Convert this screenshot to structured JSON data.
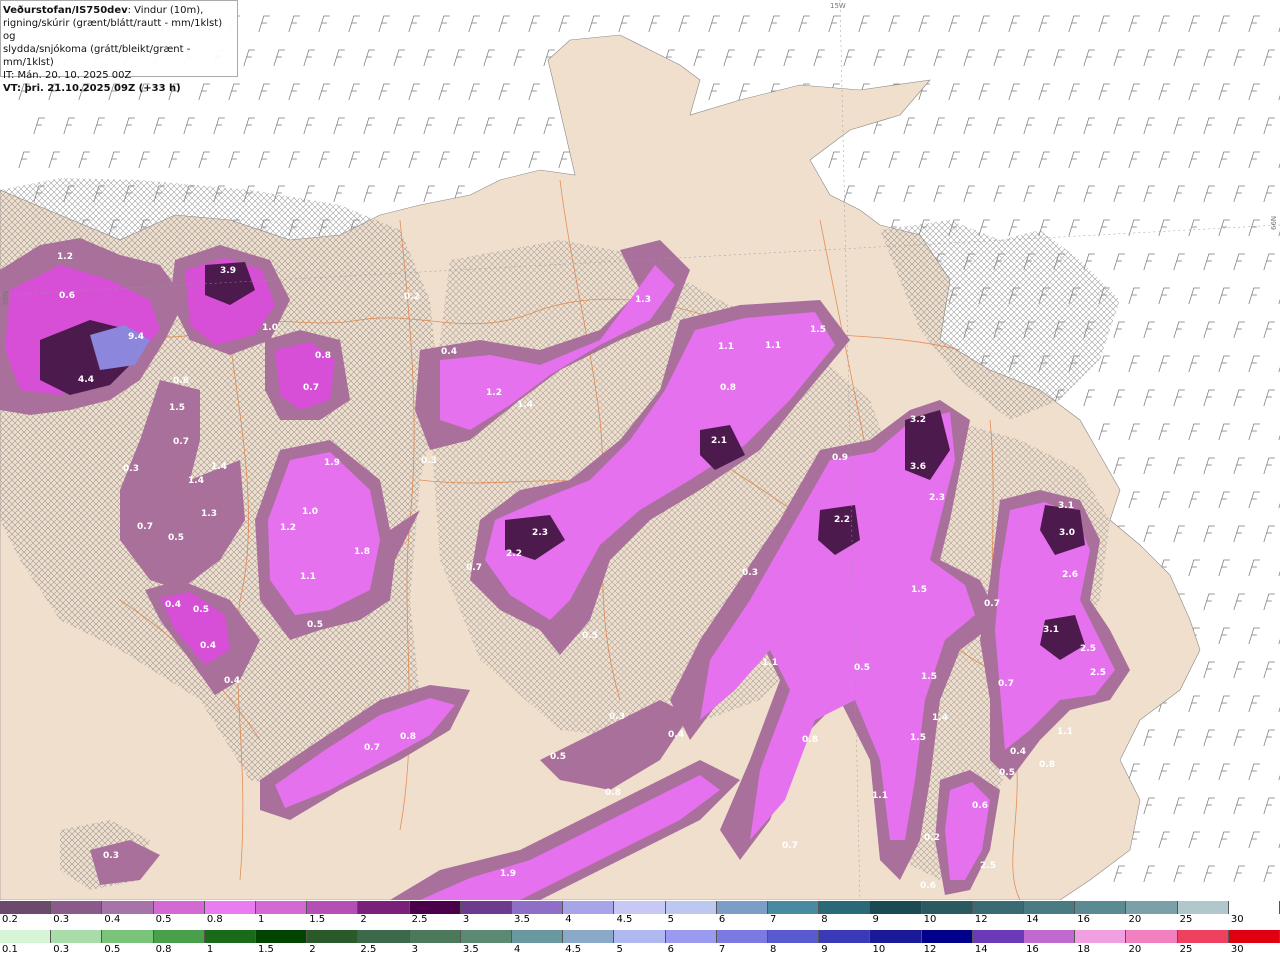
{
  "header": {
    "source": "Veðurstofan/IS750dev",
    "line1_rest": ": Vindur (10m),",
    "line2": "rigning/skúrir (grænt/blátt/rautt - mm/1klst) og",
    "line3": "slydda/snjókoma (grátt/bleikt/grænt - mm/1klst)",
    "init": "IT: Mán. 20. 10. 2025 00Z",
    "valid": "VT: þri. 21.10.2025 09Z (+33 h)"
  },
  "map": {
    "coord_labels": [
      "15W",
      "66N",
      "66N"
    ],
    "colors": {
      "sea": "#ffffff",
      "land": "#f0dfcd",
      "roads": "#e07a3a",
      "precip_light": "#a8709a",
      "precip_mid": "#d74fd7",
      "precip_bright": "#e571ee",
      "precip_dark": "#4d1a4d",
      "precip_peak": "#8c86dc"
    },
    "precip_labels": [
      {
        "v": "1.2"
      },
      {
        "v": "3.9"
      },
      {
        "v": "0.6"
      },
      {
        "v": "9.4"
      },
      {
        "v": "4.4"
      },
      {
        "v": "1.0"
      },
      {
        "v": "0.8"
      },
      {
        "v": "0.7"
      },
      {
        "v": "0.8"
      },
      {
        "v": "1.5"
      },
      {
        "v": "0.7"
      },
      {
        "v": "0.3"
      },
      {
        "v": "1.4"
      },
      {
        "v": "1.4"
      },
      {
        "v": "1.3"
      },
      {
        "v": "0.7"
      },
      {
        "v": "0.5"
      },
      {
        "v": "1.9"
      },
      {
        "v": "1.0"
      },
      {
        "v": "1.2"
      },
      {
        "v": "1.8"
      },
      {
        "v": "1.1"
      },
      {
        "v": "0.4"
      },
      {
        "v": "0.5"
      },
      {
        "v": "0.4"
      },
      {
        "v": "0.4"
      },
      {
        "v": "0.5"
      },
      {
        "v": "0.2"
      },
      {
        "v": "0.4"
      },
      {
        "v": "1.2"
      },
      {
        "v": "1.4"
      },
      {
        "v": "0.3"
      },
      {
        "v": "1.3"
      },
      {
        "v": "1.1"
      },
      {
        "v": "1.1"
      },
      {
        "v": "1.5"
      },
      {
        "v": "0.8"
      },
      {
        "v": "2.1"
      },
      {
        "v": "2.3"
      },
      {
        "v": "2.2"
      },
      {
        "v": "0.7"
      },
      {
        "v": "0.5"
      },
      {
        "v": "0.9"
      },
      {
        "v": "3.2"
      },
      {
        "v": "3.6"
      },
      {
        "v": "2.3"
      },
      {
        "v": "2.2"
      },
      {
        "v": "0.3"
      },
      {
        "v": "1.5"
      },
      {
        "v": "0.7"
      },
      {
        "v": "3.1"
      },
      {
        "v": "3.0"
      },
      {
        "v": "2.6"
      },
      {
        "v": "3.1"
      },
      {
        "v": "2.5"
      },
      {
        "v": "2.5"
      },
      {
        "v": "0.7"
      },
      {
        "v": "1.1"
      },
      {
        "v": "0.5"
      },
      {
        "v": "1.5"
      },
      {
        "v": "1.4"
      },
      {
        "v": "1.5"
      },
      {
        "v": "0.7"
      },
      {
        "v": "0.8"
      },
      {
        "v": "0.5"
      },
      {
        "v": "0.3"
      },
      {
        "v": "0.4"
      },
      {
        "v": "0.8"
      },
      {
        "v": "0.8"
      },
      {
        "v": "1.1"
      },
      {
        "v": "0.4"
      },
      {
        "v": "0.5"
      },
      {
        "v": "0.8"
      },
      {
        "v": "1.1"
      },
      {
        "v": "0.6"
      },
      {
        "v": "0.2"
      },
      {
        "v": "0.7"
      },
      {
        "v": "2.5"
      },
      {
        "v": "0.6"
      },
      {
        "v": "0.3"
      },
      {
        "v": "1.9"
      }
    ]
  },
  "legend_rain_snow": {
    "labels": [
      "0.2",
      "0.3",
      "0.4",
      "0.5",
      "0.8",
      "1",
      "1.5",
      "2",
      "2.5",
      "3",
      "3.5",
      "4",
      "4.5",
      "5",
      "6",
      "7",
      "8",
      "9",
      "10",
      "12",
      "14",
      "16",
      "20",
      "25",
      "30"
    ],
    "colors": [
      "#6b4a6b",
      "#8a5a8a",
      "#a874a8",
      "#d36ad3",
      "#ea7bf0",
      "#d36ad3",
      "#b54fb5",
      "#7a1f7a",
      "#4b004b",
      "#6e3a8e",
      "#8f6ec7",
      "#a8a4e8",
      "#c8c8f5",
      "#bcc8f0",
      "#7a9ec8",
      "#4a8aa0",
      "#2a6a78",
      "#1a4a52",
      "#2a5a60",
      "#3a6a72",
      "#4a7a82",
      "#5a8a92",
      "#7aa0a8",
      "#b0c8cc",
      "#ffffff"
    ]
  },
  "legend_rain": {
    "labels": [
      "0.1",
      "0.3",
      "0.5",
      "0.8",
      "1",
      "1.5",
      "2",
      "2.5",
      "3",
      "3.5",
      "4",
      "4.5",
      "5",
      "6",
      "7",
      "8",
      "9",
      "10",
      "12",
      "14",
      "16",
      "18",
      "20",
      "25",
      "30"
    ],
    "colors": [
      "#d6f5d6",
      "#a8dca8",
      "#7ac47a",
      "#4aa04a",
      "#1a6a1a",
      "#004400",
      "#2a5a2a",
      "#3a6a4a",
      "#4a7a5a",
      "#5a8a72",
      "#6a98a0",
      "#8aa8c8",
      "#b0b8f0",
      "#9a9af0",
      "#7a7ae0",
      "#5a5ad0",
      "#3a3ab8",
      "#1a1a98",
      "#00008a",
      "#6a3ab8",
      "#c06ad0",
      "#f0a0e0",
      "#f080c0",
      "#f04060",
      "#e00010"
    ]
  }
}
